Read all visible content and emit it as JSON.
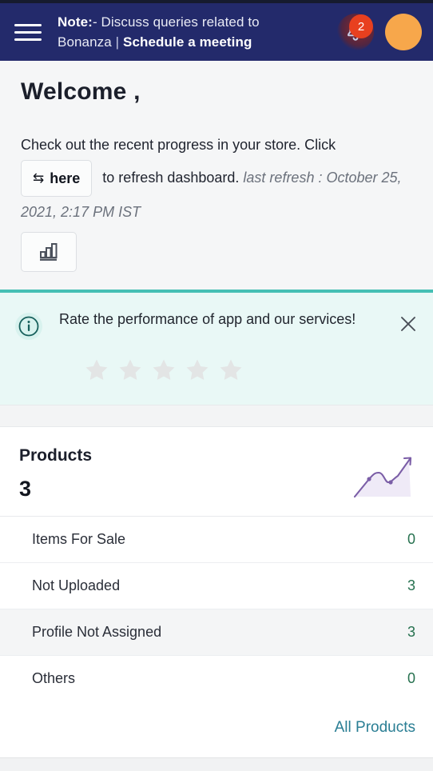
{
  "header": {
    "menu_icon": "hamburger-menu-icon",
    "note_label": "Note:",
    "note_text_1": "- Discuss queries related to",
    "note_text_2": "Bonanza",
    "note_separator": "|",
    "note_link": "Schedule a meeting",
    "bell_icon": "notification-bell-icon",
    "notification_count": "2",
    "avatar_icon": "user-avatar"
  },
  "welcome": {
    "title": "Welcome ,",
    "intro": "Check out the recent progress in your store. Click",
    "refresh_button_label": "here",
    "refresh_button_icon": "swap-arrows-icon",
    "after_button": "to refresh dashboard.",
    "last_refresh": "last refresh : October 25, 2021, 2:17 PM IST",
    "chart_button_icon": "bar-chart-icon"
  },
  "rating_banner": {
    "info_icon": "info-circle-icon",
    "message": "Rate the performance of app and our services!",
    "close_icon": "close-icon",
    "stars_total": 5,
    "stars_filled": 0
  },
  "products_card": {
    "title": "Products",
    "count": "3",
    "sparkline_icon": "trend-up-sparkline-icon",
    "rows": [
      {
        "label": "Items For Sale",
        "value": "0",
        "highlighted": false
      },
      {
        "label": "Not Uploaded",
        "value": "3",
        "highlighted": false
      },
      {
        "label": "Profile Not Assigned",
        "value": "3",
        "highlighted": true
      },
      {
        "label": "Others",
        "value": "0",
        "highlighted": false
      }
    ],
    "footer_link": "All Products"
  },
  "colors": {
    "header_bg": "#232a6b",
    "badge_red": "#e8401f",
    "avatar_orange": "#f7a74b",
    "banner_bg": "#e9f8f6",
    "banner_accent": "#45bfb4",
    "value_green": "#26714f",
    "link_teal": "#2a7e94",
    "sparkline_purple": "#7b5ea7"
  }
}
